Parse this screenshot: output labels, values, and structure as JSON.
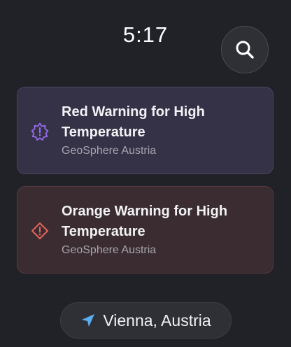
{
  "status": {
    "time": "5:17"
  },
  "search": {
    "icon": "search-icon"
  },
  "warnings": [
    {
      "title": "Red Warning for High Temperature",
      "source": "GeoSphere Austria",
      "icon": "warning-badge-icon",
      "color": "#9b6cf0"
    },
    {
      "title": "Orange Warning for High Temperature",
      "source": "GeoSphere Austria",
      "icon": "warning-diamond-icon",
      "color": "#e4655a"
    }
  ],
  "location": {
    "label": "Vienna, Austria",
    "icon": "location-arrow-icon",
    "color": "#5aaef2"
  }
}
